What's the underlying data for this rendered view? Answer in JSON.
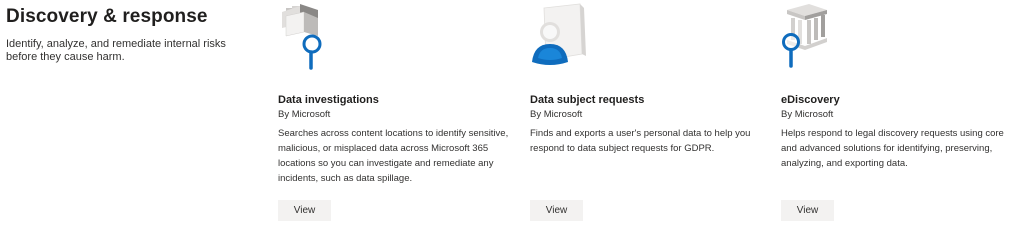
{
  "section": {
    "title": "Discovery & response",
    "description": "Identify, analyze, and remediate internal risks before they cause harm."
  },
  "cards": [
    {
      "title": "Data investigations",
      "publisher": "By Microsoft",
      "description": "Searches across content locations to identify sensitive, malicious, or misplaced data across Microsoft 365 locations so you can investigate and remediate any incidents, such as data spillage.",
      "button_label": "View",
      "icon": "data-investigation-magnifier-icon"
    },
    {
      "title": "Data subject requests",
      "publisher": "By Microsoft",
      "description": "Finds and exports a user's personal data to help you respond to data subject requests for GDPR.",
      "button_label": "View",
      "icon": "data-subject-person-document-icon"
    },
    {
      "title": "eDiscovery",
      "publisher": "By Microsoft",
      "description": "Helps respond to legal discovery requests using core and advanced solutions for identifying, preserving, analyzing, and exporting data.",
      "button_label": "View",
      "icon": "ediscovery-courthouse-magnifier-icon"
    }
  ],
  "colors": {
    "accent_blue": "#0f6cbd",
    "button_bg": "#f3f2f1"
  }
}
